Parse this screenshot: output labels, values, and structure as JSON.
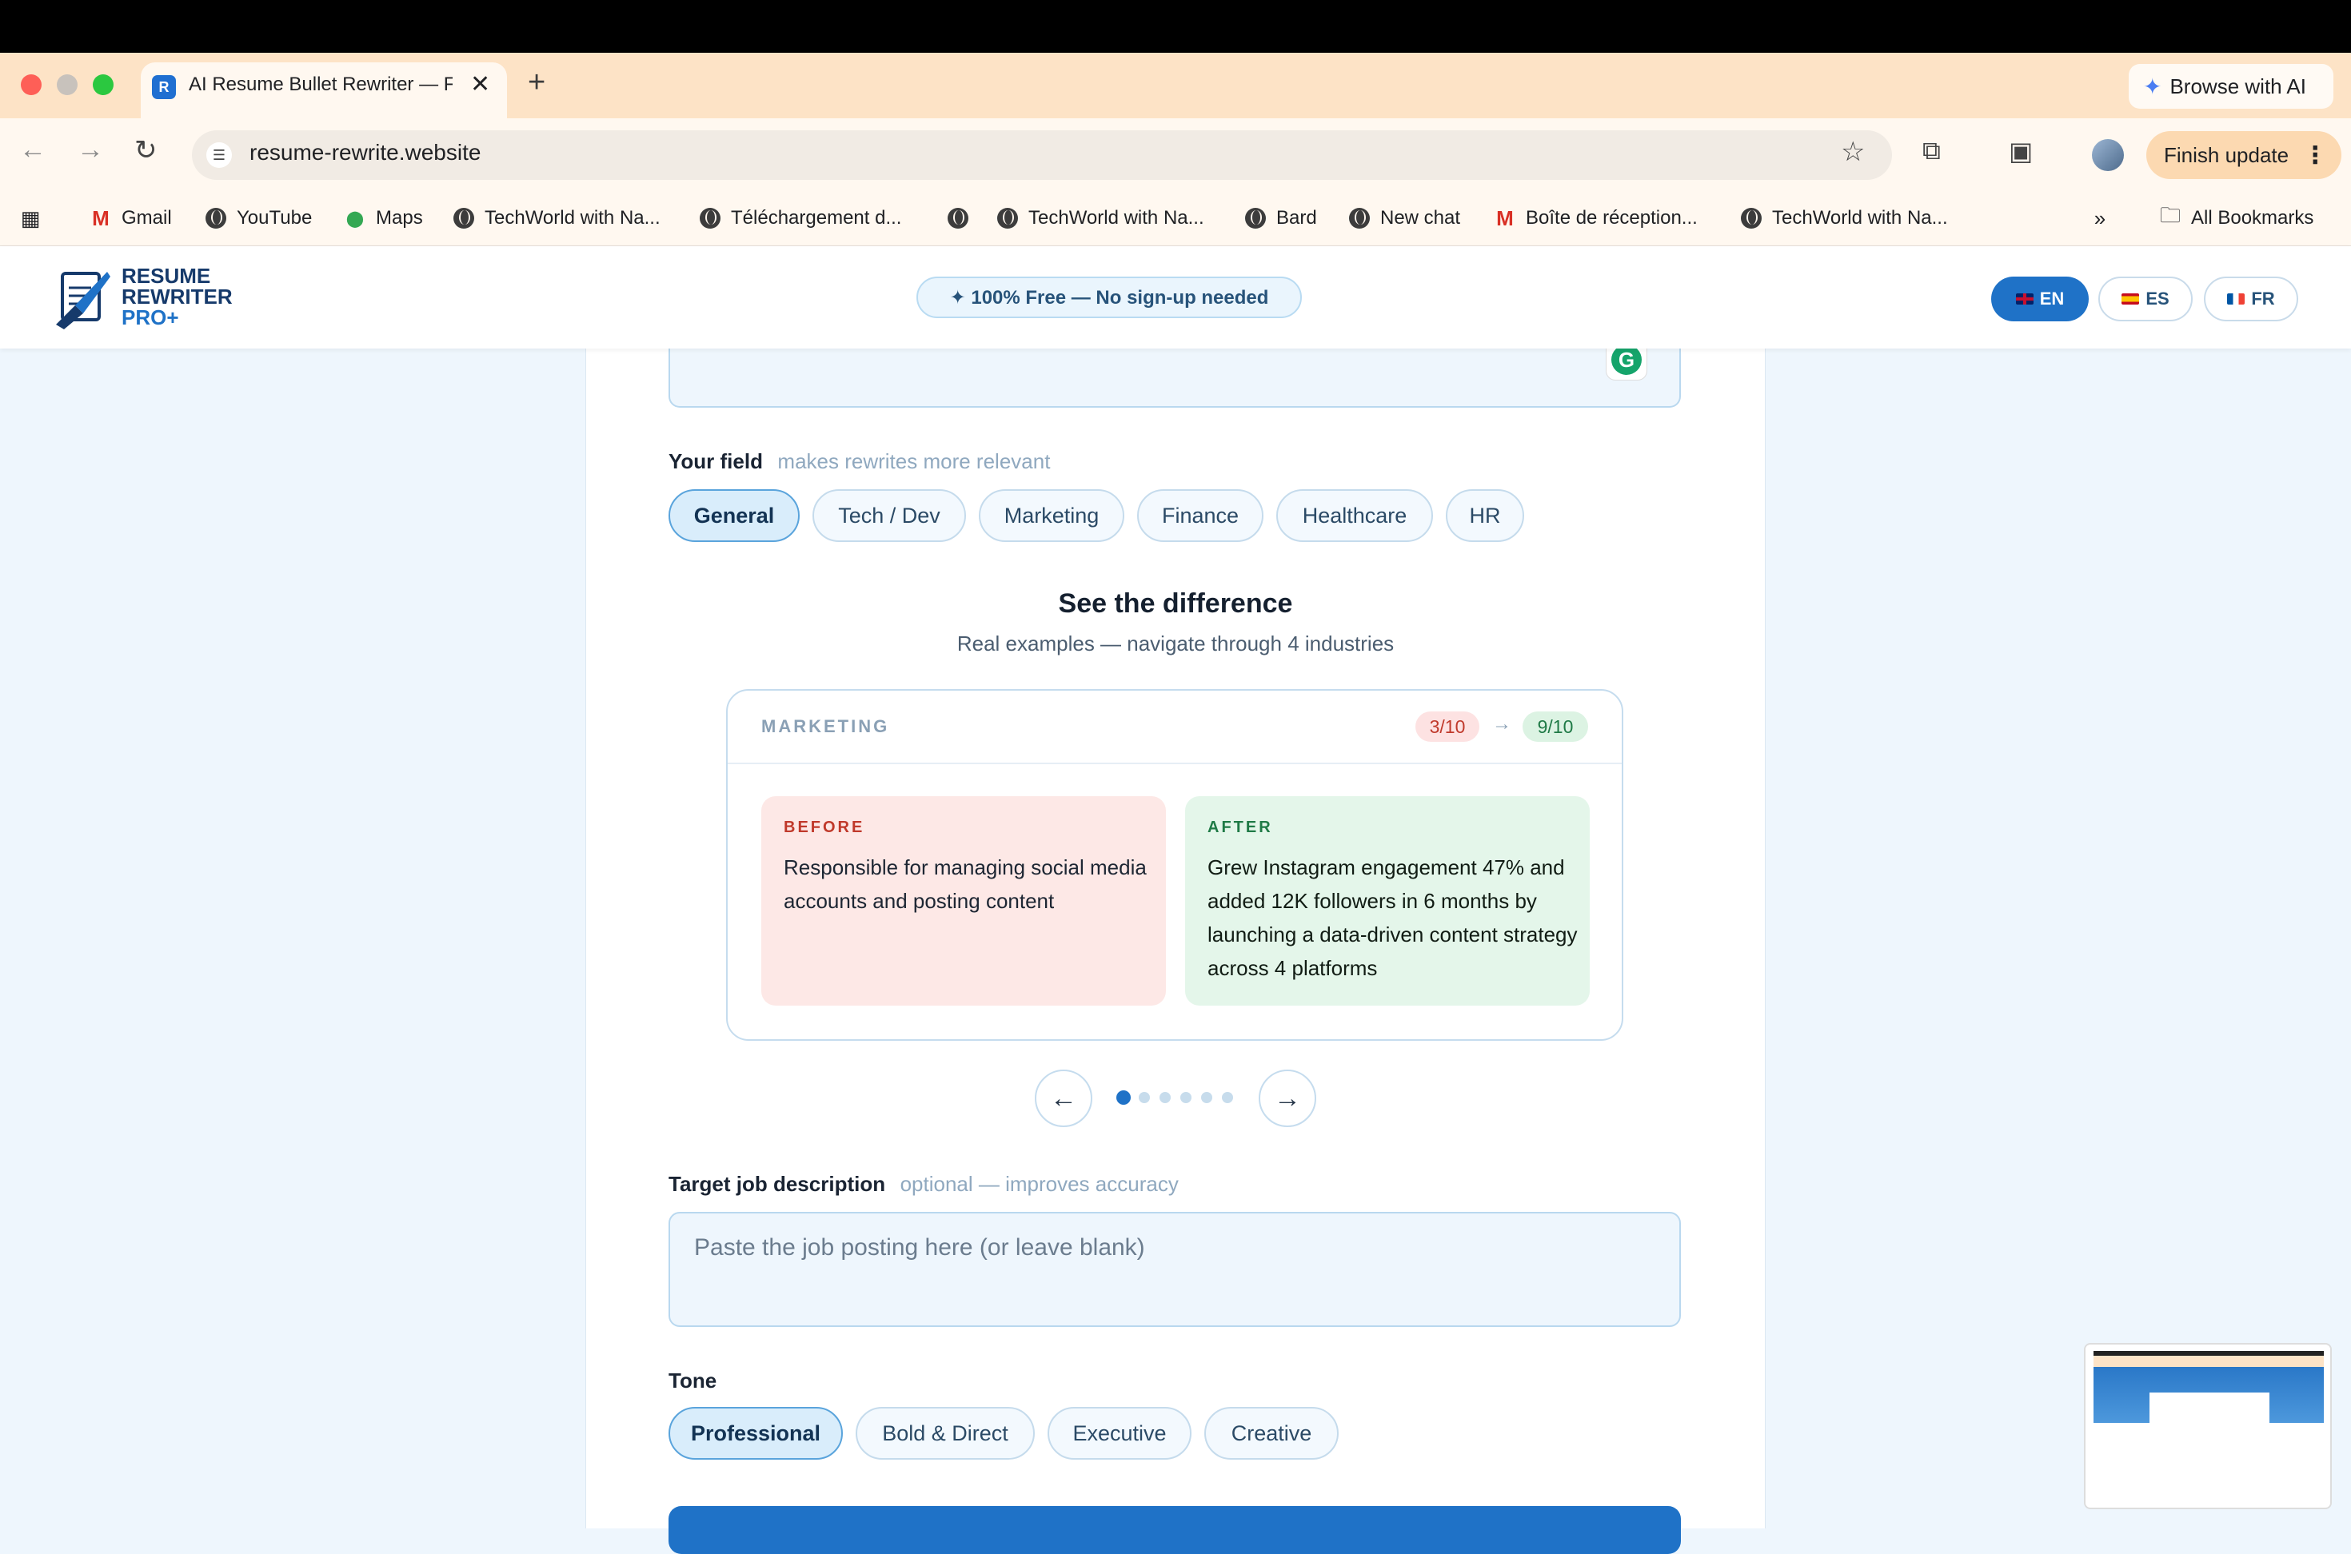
{
  "browser": {
    "tab_title": "AI Resume Bullet Rewriter — F",
    "tab_favicon_letter": "R",
    "url": "resume-rewrite.website",
    "browse_ai_label": "Browse with AI",
    "finish_update_label": "Finish update",
    "bookmarks": [
      {
        "label": "Gmail",
        "icon": "gmail-icon"
      },
      {
        "label": "YouTube",
        "icon": "globe-icon"
      },
      {
        "label": "Maps",
        "icon": "maps-icon"
      },
      {
        "label": "TechWorld with Na...",
        "icon": "globe-icon"
      },
      {
        "label": "Téléchargement d...",
        "icon": "globe-icon"
      },
      {
        "label": "",
        "icon": "globe-icon"
      },
      {
        "label": "TechWorld with Na...",
        "icon": "globe-icon"
      },
      {
        "label": "Bard",
        "icon": "globe-icon"
      },
      {
        "label": "New chat",
        "icon": "globe-icon"
      },
      {
        "label": "Boîte de réception...",
        "icon": "gmail-icon"
      },
      {
        "label": "TechWorld with Na...",
        "icon": "globe-icon"
      }
    ],
    "all_bookmarks_label": "All Bookmarks"
  },
  "site": {
    "logo_line1": "RESUME",
    "logo_line2": "REWRITER",
    "logo_line3": "PRO+",
    "free_badge": "✦ 100% Free — No sign-up needed",
    "languages": [
      {
        "code": "EN",
        "active": true
      },
      {
        "code": "ES",
        "active": false
      },
      {
        "code": "FR",
        "active": false
      }
    ]
  },
  "field": {
    "label": "Your field",
    "hint": "makes rewrites more relevant",
    "options": [
      "General",
      "Tech / Dev",
      "Marketing",
      "Finance",
      "Healthcare",
      "HR"
    ],
    "selected": "General"
  },
  "difference": {
    "title": "See the difference",
    "subtitle": "Real examples — navigate through 4 industries",
    "category": "MARKETING",
    "score_before": "3/10",
    "score_arrow": "→",
    "score_after": "9/10",
    "before_label": "BEFORE",
    "before_text": "Responsible for managing social media accounts and posting content",
    "after_label": "AFTER",
    "after_text": "Grew Instagram engagement 47% and added 12K followers in 6 months by launching a data-driven content strategy across 4 platforms",
    "prev_symbol": "←",
    "next_symbol": "→",
    "dot_count": 6,
    "active_dot": 0
  },
  "job": {
    "label": "Target job description",
    "hint": "optional — improves accuracy",
    "placeholder": "Paste the job posting here (or leave blank)"
  },
  "tone": {
    "label": "Tone",
    "options": [
      "Professional",
      "Bold & Direct",
      "Executive",
      "Creative"
    ],
    "selected": "Professional"
  },
  "colors": {
    "accent": "#1f72c7",
    "before_bg": "#fde8e6",
    "after_bg": "#e4f6ea"
  }
}
